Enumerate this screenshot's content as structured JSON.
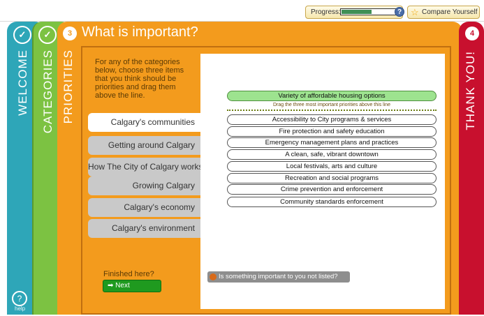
{
  "top_bar": {
    "progress_label": "Progress:",
    "progress_fraction": 0.55,
    "help_symbol": "?",
    "compare_label": "Compare Yourself",
    "compare_icon": "star-icon"
  },
  "steps": {
    "welcome": {
      "label": "WELCOME",
      "status": "✓",
      "color": "#2ea6b8"
    },
    "categories": {
      "label": "CATEGORIES",
      "status": "✓",
      "color": "#7cc242"
    },
    "priorities": {
      "label": "PRIORITIES",
      "number": "3",
      "color": "#f39b1d"
    },
    "thanks": {
      "label": "THANK YOU!",
      "number": "4",
      "color": "#c8102e"
    }
  },
  "main": {
    "title": "What is important?",
    "instructions": "For any of the categories below, choose three items that you think should be priorities and drag them above the line.",
    "categories": [
      "Calgary's communities",
      "Getting around Calgary",
      "How The City of Calgary works",
      "Growing Calgary",
      "Calgary's economy",
      "Calgary's environment"
    ],
    "finished_label": "Finished here?",
    "next_label": "Next",
    "selected_items": [
      "Variety of affordable housing options"
    ],
    "drag_hint": "Drag the three most important priorities above this line",
    "items": [
      "Accessibility to City programs & services",
      "Fire protection and safety education",
      "Emergency management plans and practices",
      "A clean, safe, vibrant downtown",
      "Local festivals, arts and culture",
      "Recreation and social programs",
      "Crime prevention and enforcement",
      "Community standards enforcement"
    ],
    "other_label": "Is something important to you not listed?"
  },
  "help": {
    "symbol": "?",
    "label": "help"
  }
}
